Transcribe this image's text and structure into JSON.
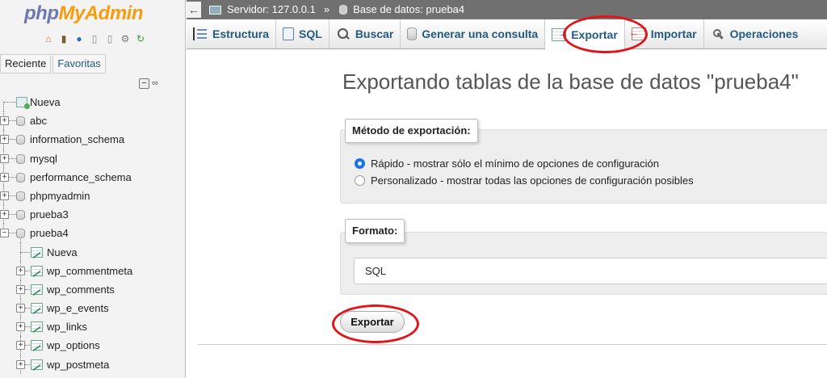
{
  "app": {
    "logo": {
      "php": "php",
      "my": "My",
      "admin": "Admin"
    }
  },
  "sidebar": {
    "tabs": [
      "Reciente",
      "Favoritas"
    ],
    "tree": [
      {
        "label": "Nueva",
        "kind": "new",
        "level": 0
      },
      {
        "label": "abc",
        "kind": "db",
        "level": 0
      },
      {
        "label": "information_schema",
        "kind": "db",
        "level": 0
      },
      {
        "label": "mysql",
        "kind": "db",
        "level": 0
      },
      {
        "label": "performance_schema",
        "kind": "db",
        "level": 0
      },
      {
        "label": "phpmyadmin",
        "kind": "db",
        "level": 0
      },
      {
        "label": "prueba3",
        "kind": "db",
        "level": 0
      },
      {
        "label": "prueba4",
        "kind": "db",
        "level": 0,
        "expanded": true
      },
      {
        "label": "Nueva",
        "kind": "new",
        "level": 1
      },
      {
        "label": "wp_commentmeta",
        "kind": "table",
        "level": 1
      },
      {
        "label": "wp_comments",
        "kind": "table",
        "level": 1
      },
      {
        "label": "wp_e_events",
        "kind": "table",
        "level": 1
      },
      {
        "label": "wp_links",
        "kind": "table",
        "level": 1
      },
      {
        "label": "wp_options",
        "kind": "table",
        "level": 1
      },
      {
        "label": "wp_postmeta",
        "kind": "table",
        "level": 1
      }
    ]
  },
  "breadcrumb": {
    "server": "Servidor: 127.0.0.1",
    "separator": "»",
    "database": "Base de datos: prueba4"
  },
  "tabs": [
    {
      "label": "Estructura",
      "icon": "structure-icon",
      "active": false
    },
    {
      "label": "SQL",
      "icon": "sql-icon",
      "active": false
    },
    {
      "label": "Buscar",
      "icon": "search-icon",
      "active": false
    },
    {
      "label": "Generar una consulta",
      "icon": "query-icon",
      "active": false
    },
    {
      "label": "Exportar",
      "icon": "export-icon",
      "active": true
    },
    {
      "label": "Importar",
      "icon": "import-icon",
      "active": false
    },
    {
      "label": "Operaciones",
      "icon": "operations-icon",
      "active": false
    }
  ],
  "main": {
    "title": "Exportando tablas de la base de datos \"prueba4\"",
    "method": {
      "legend": "Método de exportación:",
      "options": [
        {
          "label": "Rápido - mostrar sólo el mínimo de opciones de configuración",
          "checked": true
        },
        {
          "label": "Personalizado - mostrar todas las opciones de configuración posibles",
          "checked": false
        }
      ]
    },
    "format": {
      "legend": "Formato:",
      "selected": "SQL"
    },
    "export_button": "Exportar"
  },
  "colors": {
    "link": "#235a81",
    "topbar": "#707070",
    "annotation": "#e0141b",
    "radio_checked": "#1a73e8"
  }
}
